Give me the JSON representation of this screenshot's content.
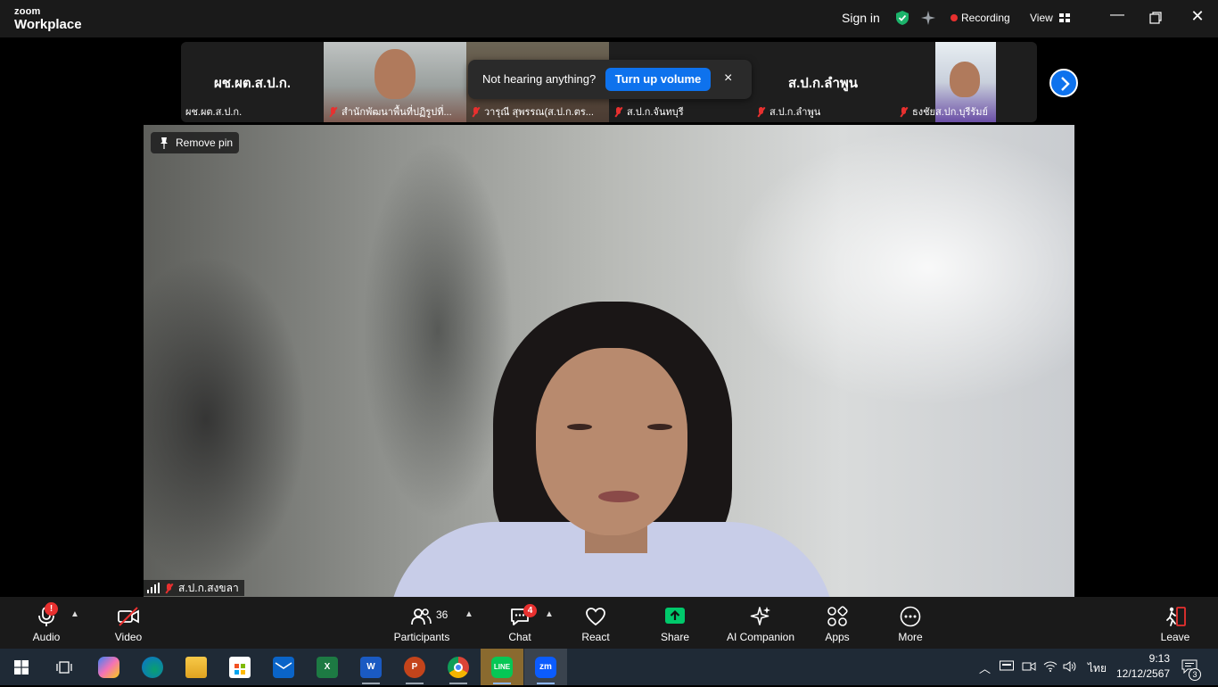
{
  "title_bar": {
    "brand_top": "zoom",
    "brand_bottom": "Workplace",
    "sign_in": "Sign in",
    "recording": "Recording",
    "view": "View"
  },
  "gallery": {
    "tiles": [
      {
        "big_label": "ผช.ผต.ส.ป.ก.",
        "name": "ผช.ผต.ส.ป.ก."
      },
      {
        "name": "สำนักพัฒนาพื้นที่ปฏิรูปที่..."
      },
      {
        "name": "วารุณี สุพรรณ(ส.ป.ก.ตร..."
      },
      {
        "name": "ส.ป.ก.จันทบุรี"
      },
      {
        "big_label": "ส.ป.ก.ลำพูน",
        "name": "ส.ป.ก.ลำพูน"
      },
      {
        "name": "ธงชัยส.ปก.บุรีรัมย์"
      }
    ]
  },
  "toast": {
    "message": "Not hearing anything?",
    "button": "Turn up volume",
    "close": "×"
  },
  "main_video": {
    "remove_pin": "Remove pin",
    "name": "ส.ป.ก.สงขลา"
  },
  "toolbar": {
    "audio": "Audio",
    "audio_badge": "!",
    "video": "Video",
    "participants": "Participants",
    "participants_count": "36",
    "chat": "Chat",
    "chat_badge": "4",
    "react": "React",
    "share": "Share",
    "ai_companion": "AI Companion",
    "apps": "Apps",
    "more": "More",
    "leave": "Leave"
  },
  "taskbar": {
    "apps": [
      "start",
      "task-view",
      "copilot",
      "edge",
      "file-explorer",
      "store",
      "mail",
      "excel",
      "word",
      "powerpoint",
      "chrome",
      "line",
      "zoom"
    ],
    "line_label": "LINE",
    "zoom_label": "zm",
    "excel_label": "X",
    "word_label": "W",
    "ppt_label": "P",
    "language": "ไทย",
    "time": "9:13",
    "date": "12/12/2567",
    "notifications": "3"
  },
  "colors": {
    "accent": "#0e72ed",
    "danger": "#e8302f",
    "share": "#00c96b"
  }
}
